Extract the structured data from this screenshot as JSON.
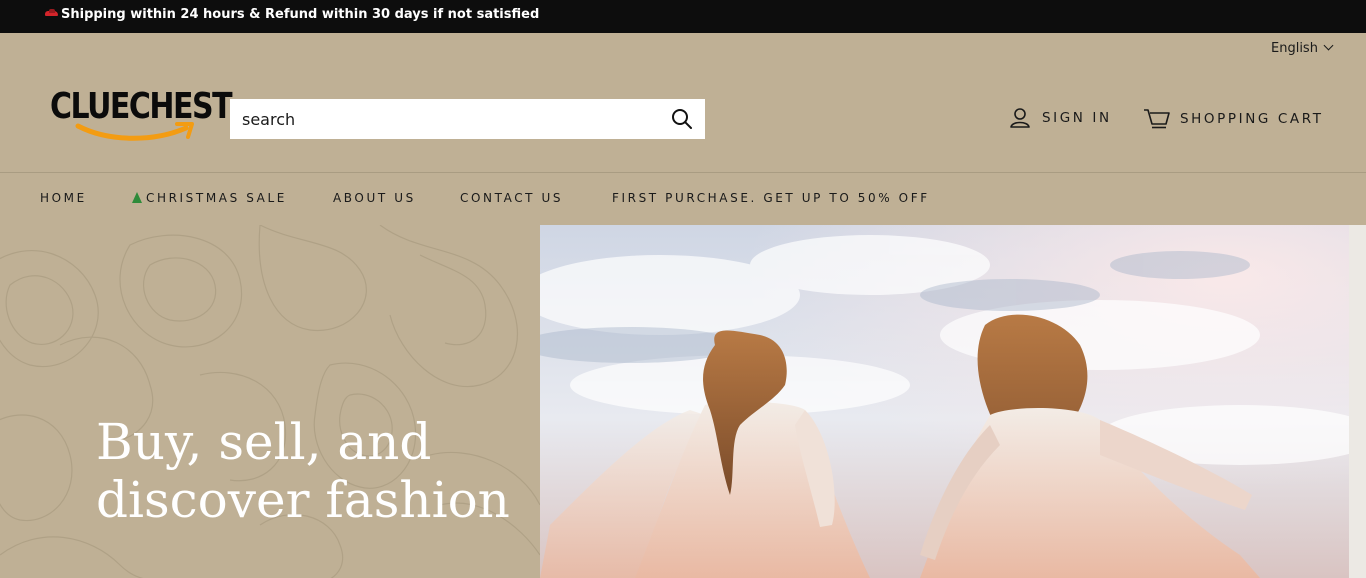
{
  "announcement": {
    "text": "Shipping within 24 hours & Refund within 30 days if not satisfied",
    "icon": "car-icon"
  },
  "language": {
    "selected": "English"
  },
  "logo": {
    "text": "CLUECHEST"
  },
  "search": {
    "placeholder": "search",
    "value": ""
  },
  "account": {
    "sign_in_label": "SIGN IN",
    "cart_label": "SHOPPING CART"
  },
  "nav": {
    "items": [
      {
        "label": "HOME"
      },
      {
        "label": "CHRISTMAS SALE",
        "icon": "christmas-tree-icon"
      },
      {
        "label": "ABOUT US"
      },
      {
        "label": "CONTACT US"
      },
      {
        "label": "FIRST PURCHASE. GET UP TO 50% OFF"
      }
    ]
  },
  "hero": {
    "headline": "Buy, sell, and discover fashion"
  },
  "colors": {
    "header_bg": "#bfb095",
    "announcement_bg": "#0d0d0d",
    "logo_arrow": "#f39c12",
    "hero_text": "#ffffff"
  }
}
